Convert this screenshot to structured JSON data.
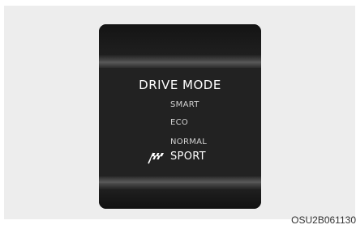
{
  "display": {
    "title": "DRIVE MODE",
    "modes": [
      {
        "label": "SMART",
        "selected": false
      },
      {
        "label": "ECO",
        "selected": false
      },
      {
        "label": "NORMAL",
        "selected": false
      },
      {
        "label": "SPORT",
        "selected": true,
        "icon": "checkered-flag-icon"
      }
    ]
  },
  "caption": "OSU2B061130"
}
